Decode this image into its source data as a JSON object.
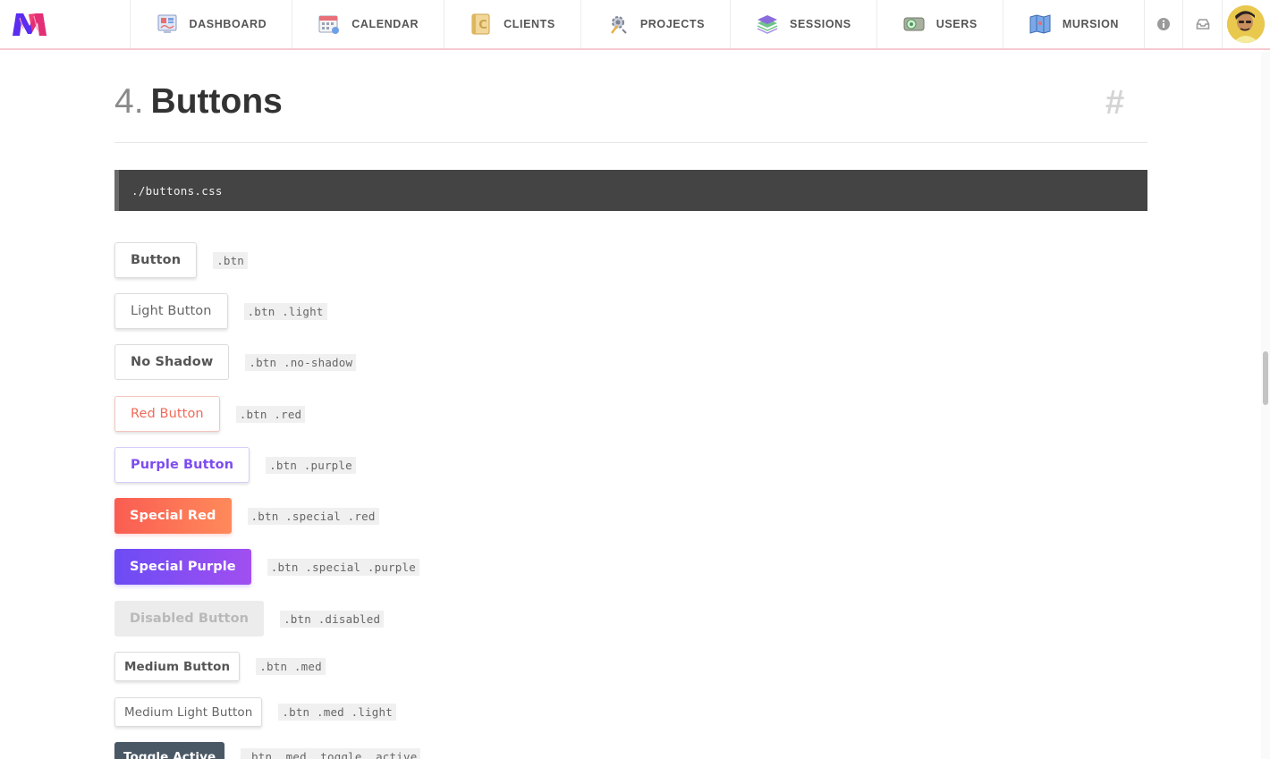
{
  "nav": {
    "items": [
      {
        "label": "DASHBOARD",
        "icon": "dashboard-icon"
      },
      {
        "label": "CALENDAR",
        "icon": "calendar-icon"
      },
      {
        "label": "CLIENTS",
        "icon": "clients-icon"
      },
      {
        "label": "PROJECTS",
        "icon": "projects-icon"
      },
      {
        "label": "SESSIONS",
        "icon": "sessions-icon"
      },
      {
        "label": "USERS",
        "icon": "users-icon"
      },
      {
        "label": "MURSION",
        "icon": "mursion-icon"
      }
    ],
    "info_icon": "info-icon",
    "inbox_icon": "inbox-icon",
    "accent_color": "#f6c9d0"
  },
  "section": {
    "number": "4.",
    "title": "Buttons",
    "anchor": "#",
    "file": "./buttons.css"
  },
  "buttons": [
    {
      "label": "Button",
      "code": ".btn"
    },
    {
      "label": "Light Button",
      "code": ".btn .light"
    },
    {
      "label": "No Shadow",
      "code": ".btn .no-shadow"
    },
    {
      "label": "Red Button",
      "code": ".btn .red"
    },
    {
      "label": "Purple Button",
      "code": ".btn .purple"
    },
    {
      "label": "Special Red",
      "code": ".btn .special .red"
    },
    {
      "label": "Special Purple",
      "code": ".btn .special .purple"
    },
    {
      "label": "Disabled Button",
      "code": ".btn .disabled"
    },
    {
      "label": "Medium Button",
      "code": ".btn .med"
    },
    {
      "label": "Medium Light Button",
      "code": ".btn .med .light"
    },
    {
      "label": "Toggle Active",
      "code": ".btn .med .toggle .active"
    }
  ],
  "colors": {
    "red": "#f06a58",
    "purple": "#7d4cf0",
    "special_red_start": "#fa5d52",
    "special_red_end": "#ff8a5a",
    "special_purple_start": "#6c4cf5",
    "special_purple_end": "#a14ff0",
    "toggle_active": "#4a5866",
    "code_bar": "#444444"
  }
}
